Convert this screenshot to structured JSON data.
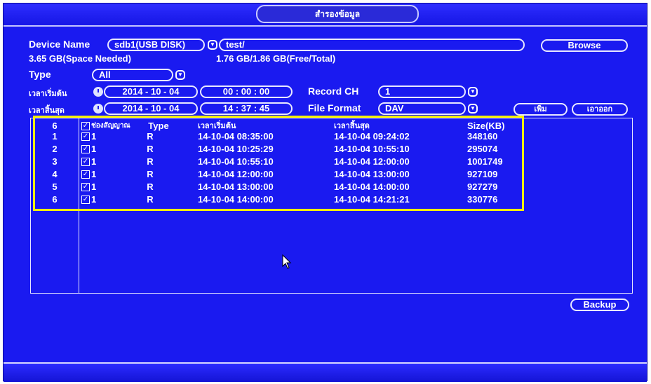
{
  "title": "สำรองข้อมูล",
  "device": {
    "label": "Device Name",
    "selected": "sdb1(USB DISK)",
    "path": "test/",
    "browse_label": "Browse",
    "space_needed": "3.65 GB(Space Needed)",
    "free_total": "1.76 GB/1.86 GB(Free/Total)"
  },
  "filters": {
    "type_label": "Type",
    "type_value": "All",
    "start_label": "เวลาเริ่มต้น",
    "start_date": "2014 - 10 - 04",
    "start_time": "00 : 00 : 00",
    "end_label": "เวลาสิ้นสุด",
    "end_date": "2014 - 10 - 04",
    "end_time": "14 : 37 : 45",
    "record_ch_label": "Record CH",
    "record_ch_value": "1",
    "file_format_label": "File Format",
    "file_format_value": "DAV",
    "add_button": "เพิ่ม",
    "remove_button": "เอาออก"
  },
  "table": {
    "header": {
      "index": "6",
      "channel": "ช่องสัญญาณ",
      "type": "Type",
      "start": "เวลาเริ่มต้น",
      "end": "เวลาสิ้นสุด",
      "size": "Size(KB)"
    },
    "rows": [
      {
        "index": "1",
        "channel": "1",
        "type": "R",
        "start": "14-10-04 08:35:00",
        "end": "14-10-04 09:24:02",
        "size": "348160"
      },
      {
        "index": "2",
        "channel": "1",
        "type": "R",
        "start": "14-10-04 10:25:29",
        "end": "14-10-04 10:55:10",
        "size": "295074"
      },
      {
        "index": "3",
        "channel": "1",
        "type": "R",
        "start": "14-10-04 10:55:10",
        "end": "14-10-04 12:00:00",
        "size": "1001749"
      },
      {
        "index": "4",
        "channel": "1",
        "type": "R",
        "start": "14-10-04 12:00:00",
        "end": "14-10-04 13:00:00",
        "size": "927109"
      },
      {
        "index": "5",
        "channel": "1",
        "type": "R",
        "start": "14-10-04 13:00:00",
        "end": "14-10-04 14:00:00",
        "size": "927279"
      },
      {
        "index": "6",
        "channel": "1",
        "type": "R",
        "start": "14-10-04 14:00:00",
        "end": "14-10-04 14:21:21",
        "size": "330776"
      }
    ]
  },
  "backup_label": "Backup",
  "colors": {
    "background": "#1a1af0",
    "highlight": "#f5f000",
    "text": "#ffffff"
  }
}
